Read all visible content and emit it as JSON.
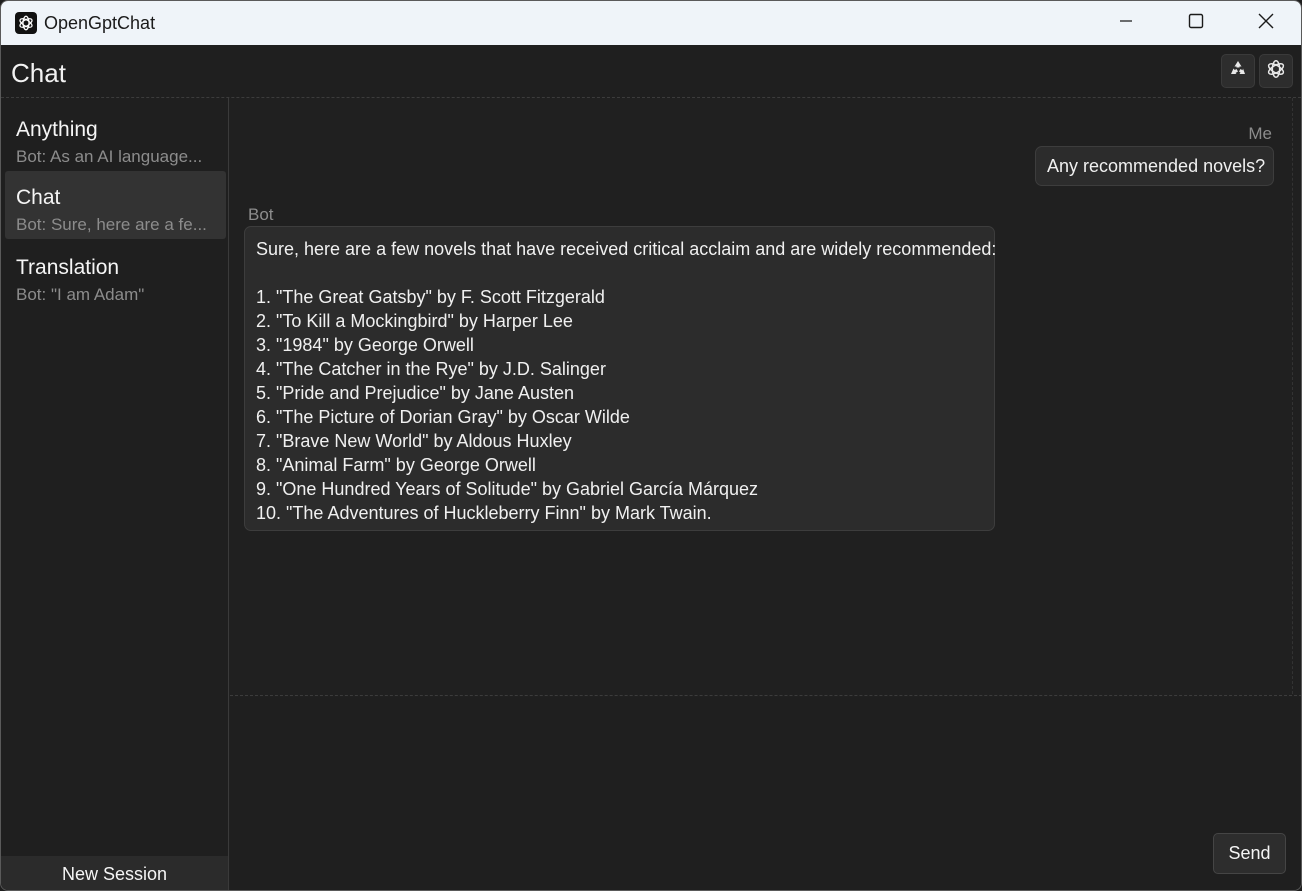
{
  "window": {
    "title": "OpenGptChat"
  },
  "header": {
    "title": "Chat"
  },
  "sidebar": {
    "sessions": [
      {
        "name": "Anything",
        "preview": "Bot: As an AI language..."
      },
      {
        "name": "Chat",
        "preview": "Bot: Sure, here are a fe..."
      },
      {
        "name": "Translation",
        "preview": "Bot: \"I am Adam\""
      }
    ],
    "new_session_label": "New Session"
  },
  "chat": {
    "me_label": "Me",
    "bot_label": "Bot",
    "user_message": "Any recommended novels?",
    "bot_message": {
      "intro": "Sure, here are a few novels that have received critical acclaim and are widely recommended:",
      "items": [
        "1. \"The Great Gatsby\" by F. Scott Fitzgerald",
        "2. \"To Kill a Mockingbird\" by Harper Lee",
        "3. \"1984\" by George Orwell",
        "4. \"The Catcher in the Rye\" by J.D. Salinger",
        "5. \"Pride and Prejudice\" by Jane Austen",
        "6. \"The Picture of Dorian Gray\" by Oscar Wilde",
        "7. \"Brave New World\" by Aldous Huxley",
        "8. \"Animal Farm\" by George Orwell",
        "9. \"One Hundred Years of Solitude\" by Gabriel García Márquez",
        "10. \"The Adventures of Huckleberry Finn\" by Mark Twain."
      ]
    }
  },
  "input": {
    "send_label": "Send"
  },
  "icons": {
    "app": "openai-logo-icon",
    "minimize": "minimize-icon",
    "maximize": "maximize-icon",
    "close": "close-icon",
    "recycle": "recycle-icon",
    "settings": "gear-icon"
  }
}
